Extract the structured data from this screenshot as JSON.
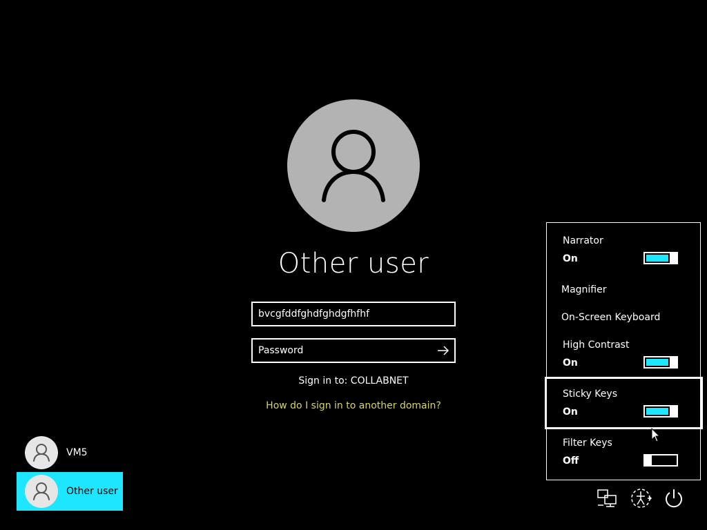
{
  "login": {
    "username": "Other user",
    "user_field_value": "bvcgfddfghdfghdgfhfhf",
    "password_placeholder": "Password",
    "sign_in_to": "Sign in to: COLLABNET",
    "domain_link": "How do I sign in to another domain?"
  },
  "user_tiles": [
    {
      "label": "VM5",
      "selected": false
    },
    {
      "label": "Other user",
      "selected": true
    }
  ],
  "ease_of_access": {
    "items": [
      {
        "name": "Narrator",
        "state": "On",
        "toggle": true,
        "on": true
      },
      {
        "name": "Magnifier"
      },
      {
        "name": "On-Screen Keyboard"
      },
      {
        "name": "High Contrast",
        "state": "On",
        "toggle": true,
        "on": true
      },
      {
        "name": "Sticky Keys",
        "state": "On",
        "toggle": true,
        "on": true,
        "focused": true
      },
      {
        "name": "Filter Keys",
        "state": "Off",
        "toggle": true,
        "on": false
      }
    ]
  },
  "system_icons": [
    "network-icon",
    "ease-of-access-icon",
    "power-icon"
  ],
  "colors": {
    "background": "#000000",
    "accent": "#1ee6ff",
    "link": "#d4d469",
    "avatar": "#b3b3b3"
  }
}
